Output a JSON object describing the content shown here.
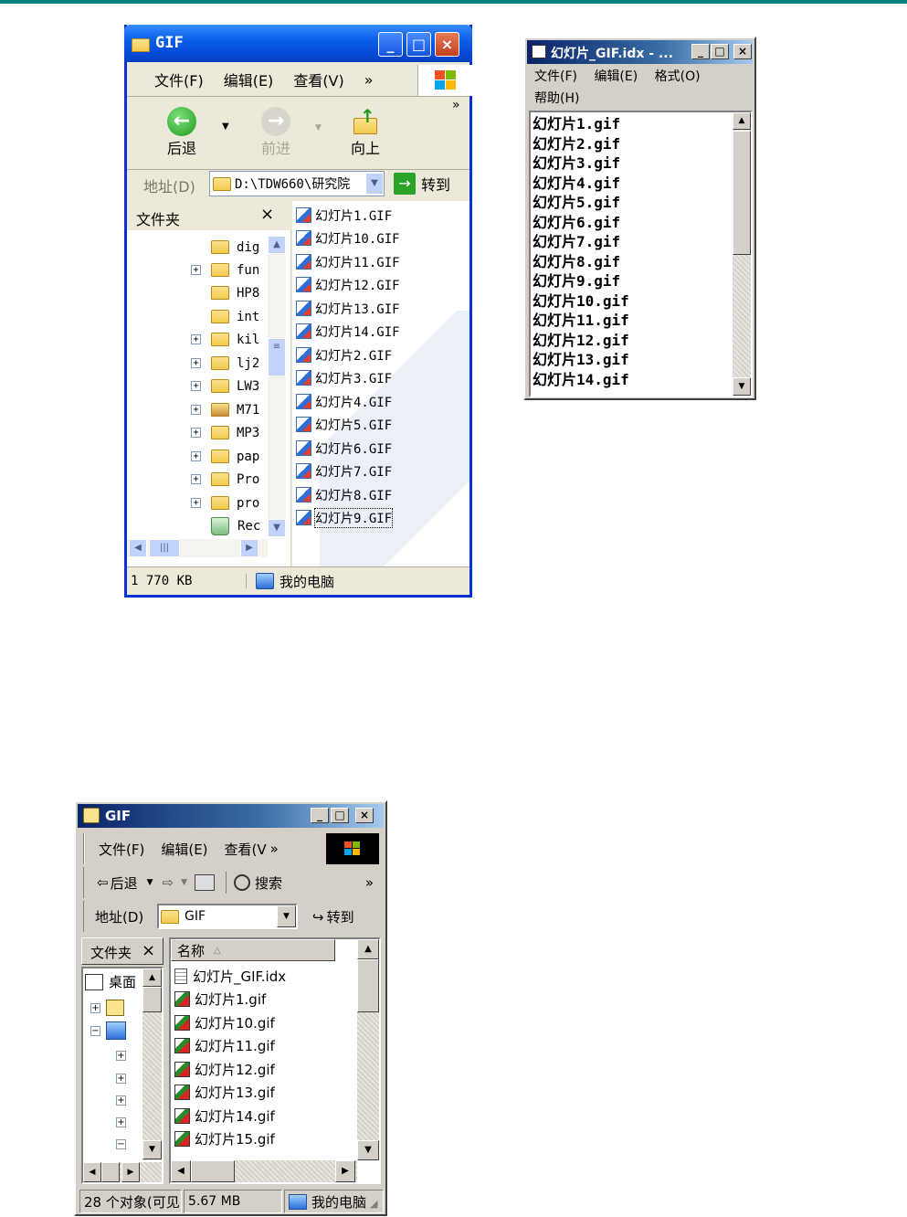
{
  "explorer_xp": {
    "title": "GIF",
    "menu": [
      "文件(F)",
      "编辑(E)",
      "查看(V)",
      "»"
    ],
    "toolbar": {
      "back": "后退",
      "forward": "前进",
      "up": "向上",
      "more": "»"
    },
    "address": {
      "label": "地址(D)",
      "value": "D:\\TDW660\\研究院",
      "go": "转到"
    },
    "folders_pane": {
      "title": "文件夹",
      "close": "×"
    },
    "tree": [
      "dig",
      "fun",
      "HP8",
      "int",
      "kil",
      "lj2",
      "LW3",
      "M71",
      "MP3",
      "pap",
      "Pro",
      "pro",
      "Rec"
    ],
    "files": [
      "幻灯片1.GIF",
      "幻灯片10.GIF",
      "幻灯片11.GIF",
      "幻灯片12.GIF",
      "幻灯片13.GIF",
      "幻灯片14.GIF",
      "幻灯片2.GIF",
      "幻灯片3.GIF",
      "幻灯片4.GIF",
      "幻灯片5.GIF",
      "幻灯片6.GIF",
      "幻灯片7.GIF",
      "幻灯片8.GIF",
      "幻灯片9.GIF"
    ],
    "status": {
      "size": "1 770 KB",
      "location": "我的电脑"
    }
  },
  "notepad": {
    "title": "幻灯片_GIF.idx - ...",
    "menu": [
      "文件(F)",
      "编辑(E)",
      "格式(O)",
      "帮助(H)"
    ],
    "lines": [
      "幻灯片1.gif",
      "幻灯片2.gif",
      "幻灯片3.gif",
      "幻灯片4.gif",
      "幻灯片5.gif",
      "幻灯片6.gif",
      "幻灯片7.gif",
      "幻灯片8.gif",
      "幻灯片9.gif",
      "幻灯片10.gif",
      "幻灯片11.gif",
      "幻灯片12.gif",
      "幻灯片13.gif",
      "幻灯片14.gif"
    ]
  },
  "explorer_classic": {
    "title": "GIF",
    "menu": [
      "文件(F)",
      "编辑(E)",
      "查看(V",
      "»"
    ],
    "toolbar": {
      "back": "后退",
      "search": "搜索",
      "more": "»"
    },
    "address": {
      "label": "地址(D)",
      "value": "GIF",
      "go": "转到"
    },
    "folders_pane": {
      "title": "文件夹",
      "close": "×",
      "desktop": "桌面"
    },
    "list_header": "名称",
    "files": [
      "幻灯片_GIF.idx",
      "幻灯片1.gif",
      "幻灯片10.gif",
      "幻灯片11.gif",
      "幻灯片12.gif",
      "幻灯片13.gif",
      "幻灯片14.gif",
      "幻灯片15.gif"
    ],
    "status": {
      "objects": "28 个对象(可见",
      "size": "5.67 MB",
      "location": "我的电脑"
    }
  },
  "colors": {
    "xp_blue": "#0831d9",
    "classic_title": "#0a246a",
    "top_rule": "#00807a"
  }
}
